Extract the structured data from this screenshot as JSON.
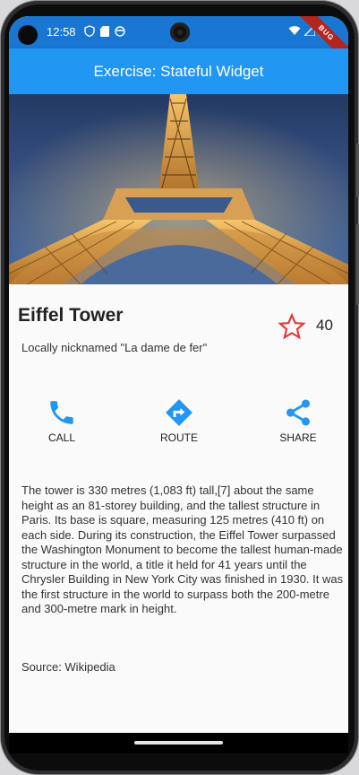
{
  "status_bar": {
    "time": "12:58",
    "left_icons": [
      "shield-icon",
      "sd-card-icon",
      "face-icon"
    ],
    "right_icons": [
      "wifi-icon",
      "signal-icon",
      "battery-icon"
    ],
    "debug_label": "BUG"
  },
  "app_bar": {
    "title": "Exercise: Stateful Widget"
  },
  "place": {
    "title": "Eiffel Tower",
    "subtitle": "Locally nicknamed \"La dame de fer\"",
    "favorite_count": "40",
    "favorite_icon": "star-outline-icon"
  },
  "actions": [
    {
      "label": "CALL",
      "icon": "phone-icon"
    },
    {
      "label": "ROUTE",
      "icon": "directions-icon"
    },
    {
      "label": "SHARE",
      "icon": "share-icon"
    }
  ],
  "description": "The tower is 330 metres (1,083 ft) tall,[7] about the same height as an 81-storey building, and the tallest structure in Paris. Its base is square, measuring 125 metres (410 ft) on each side. During its construction, the Eiffel Tower surpassed the Washington Monument to become the tallest human-made structure in the world, a title it held for 41 years until the Chrysler Building in New York City was finished in 1930. It was the first structure in the world to surpass both the 200-metre and 300-metre mark in height.",
  "source": "Source: Wikipedia",
  "colors": {
    "status_bar": "#1976d2",
    "app_bar": "#2196f3",
    "action_icon": "#2196f3",
    "star": "#e53935"
  }
}
